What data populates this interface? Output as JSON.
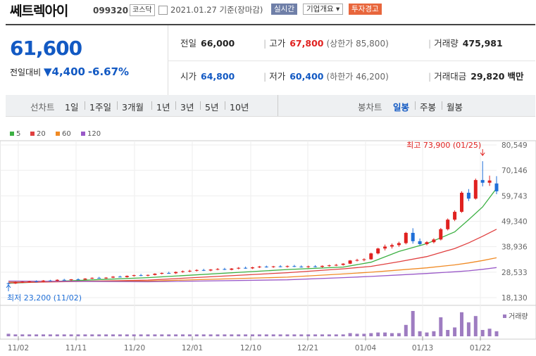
{
  "header": {
    "name": "쎄트렉아이",
    "code": "099320",
    "market": "코스닥",
    "date": "2021.01.27 기준(장마감)",
    "realtime": "실시간",
    "overview": "기업개요 ▾",
    "warning": "투자경고"
  },
  "quote": {
    "price": "61,600",
    "change_label": "전일대비",
    "change": "▼4,400",
    "change_pct": "-6.67%",
    "prev_close_label": "전일",
    "prev_close": "66,000",
    "high_label": "고가",
    "high": "67,800",
    "upper_limit": "(상한가 85,800)",
    "volume_label": "거래량",
    "volume": "475,981",
    "open_label": "시가",
    "open": "64,800",
    "low_label": "저가",
    "low": "60,400",
    "lower_limit": "(하한가 46,200)",
    "amount_label": "거래대금",
    "amount": "29,820",
    "amount_unit": "백만"
  },
  "periods": {
    "line_label": "선차트",
    "line_items": [
      "1일",
      "1주일",
      "3개월",
      "1년",
      "3년",
      "5년",
      "10년"
    ],
    "candle_label": "봉차트",
    "candle_items": [
      "일봉",
      "주봉",
      "월봉"
    ],
    "active": "일봉"
  },
  "chart_data": {
    "type": "candlestick",
    "legend": [
      {
        "name": "5",
        "color": "#3cb043"
      },
      {
        "name": "20",
        "color": "#e04040"
      },
      {
        "name": "60",
        "color": "#f08a24"
      },
      {
        "name": "120",
        "color": "#9a59c8"
      }
    ],
    "y_ticks": [
      "80,549",
      "70,146",
      "59,743",
      "49,340",
      "38,936",
      "28,533",
      "18,130"
    ],
    "x_ticks": [
      "11/02",
      "11/11",
      "11/20",
      "12/01",
      "12/10",
      "12/21",
      "01/04",
      "01/13",
      "01/22"
    ],
    "ylim": [
      18130,
      80549
    ],
    "max_label": "최고 73,900 (01/25)",
    "min_label": "최저 23,200 (11/02)",
    "volume_label": "거래량",
    "up_color": "#e0211f",
    "down_color": "#1f6fd8",
    "volume_color": "#9e7cc1",
    "candles": [
      [
        24000,
        24300,
        23200,
        23900
      ],
      [
        23900,
        24600,
        23700,
        24400
      ],
      [
        24400,
        24800,
        24100,
        24600
      ],
      [
        24600,
        25000,
        24300,
        24800
      ],
      [
        24800,
        25200,
        24400,
        24700
      ],
      [
        24700,
        25300,
        24500,
        25100
      ],
      [
        25100,
        25400,
        24800,
        25000
      ],
      [
        25000,
        25600,
        24800,
        25400
      ],
      [
        25400,
        25800,
        25100,
        25300
      ],
      [
        25300,
        25700,
        25000,
        25600
      ],
      [
        25600,
        26000,
        25300,
        25500
      ],
      [
        25500,
        26100,
        25400,
        25900
      ],
      [
        25900,
        26400,
        25700,
        26200
      ],
      [
        26200,
        26600,
        25900,
        26000
      ],
      [
        26000,
        26500,
        25800,
        26300
      ],
      [
        26300,
        26900,
        26100,
        26700
      ],
      [
        26700,
        27100,
        26400,
        26500
      ],
      [
        26500,
        27200,
        26300,
        27000
      ],
      [
        27000,
        27500,
        26700,
        27300
      ],
      [
        27300,
        27800,
        26900,
        27100
      ],
      [
        27100,
        27600,
        26800,
        27400
      ],
      [
        27400,
        28100,
        27200,
        27900
      ],
      [
        27900,
        28400,
        27600,
        28200
      ],
      [
        28200,
        28700,
        27900,
        28100
      ],
      [
        28100,
        28800,
        27800,
        28600
      ],
      [
        28600,
        29200,
        28300,
        28900
      ],
      [
        28900,
        29500,
        28500,
        29100
      ],
      [
        29100,
        29700,
        28800,
        29400
      ],
      [
        29400,
        29900,
        29000,
        29200
      ],
      [
        29200,
        29800,
        28900,
        29600
      ],
      [
        29600,
        30200,
        29300,
        29800
      ],
      [
        29800,
        30300,
        29400,
        29500
      ],
      [
        29500,
        30200,
        29300,
        30000
      ],
      [
        30000,
        30600,
        29700,
        30300
      ],
      [
        30300,
        30800,
        29900,
        30100
      ],
      [
        30100,
        30700,
        29800,
        30500
      ],
      [
        30500,
        31100,
        30200,
        30800
      ],
      [
        30800,
        31200,
        30400,
        30600
      ],
      [
        30600,
        31100,
        30300,
        30900
      ],
      [
        30900,
        31400,
        30500,
        30700
      ],
      [
        30700,
        31300,
        30400,
        31000
      ],
      [
        31000,
        31500,
        30600,
        30800
      ],
      [
        30800,
        31300,
        30400,
        30600
      ],
      [
        30600,
        31200,
        30300,
        30900
      ],
      [
        30900,
        31400,
        30500,
        30700
      ],
      [
        30700,
        31300,
        30400,
        31100
      ],
      [
        31100,
        31600,
        30800,
        31300
      ],
      [
        31300,
        31900,
        31000,
        31500
      ],
      [
        31500,
        32200,
        31200,
        32000
      ],
      [
        32000,
        33500,
        31800,
        33300
      ],
      [
        33300,
        34000,
        32900,
        33500
      ],
      [
        33500,
        34200,
        33000,
        33800
      ],
      [
        33800,
        36500,
        33600,
        36200
      ],
      [
        36200,
        38500,
        35800,
        38200
      ],
      [
        38200,
        39800,
        37400,
        39000
      ],
      [
        39000,
        40200,
        38200,
        39600
      ],
      [
        39600,
        41000,
        38900,
        40400
      ],
      [
        40400,
        45000,
        39900,
        44600
      ],
      [
        44600,
        46500,
        40200,
        41200
      ],
      [
        41200,
        42300,
        39600,
        40000
      ],
      [
        40000,
        41200,
        39500,
        40800
      ],
      [
        40800,
        42400,
        40300,
        41900
      ],
      [
        41900,
        46600,
        41500,
        46100
      ],
      [
        46100,
        50500,
        45600,
        50000
      ],
      [
        50000,
        53800,
        49400,
        53200
      ],
      [
        53200,
        61600,
        52800,
        61000
      ],
      [
        61000,
        62500,
        57600,
        58600
      ],
      [
        58600,
        66800,
        58200,
        66200
      ],
      [
        66200,
        73900,
        63600,
        65100
      ],
      [
        65100,
        68000,
        63800,
        66000
      ],
      [
        64800,
        67800,
        60400,
        61600
      ]
    ],
    "volumes": [
      4,
      3,
      3,
      3,
      3,
      3,
      3,
      3,
      3,
      3,
      3,
      3,
      3,
      3,
      3,
      3,
      3,
      3,
      3,
      3,
      3,
      3,
      3,
      3,
      3,
      3,
      3,
      3,
      3,
      3,
      3,
      3,
      3,
      3,
      3,
      3,
      3,
      3,
      3,
      3,
      3,
      3,
      3,
      3,
      3,
      3,
      3,
      3,
      3,
      5,
      4,
      4,
      5,
      6,
      6,
      5,
      5,
      18,
      40,
      8,
      6,
      8,
      30,
      10,
      14,
      38,
      22,
      32,
      10,
      12,
      8
    ],
    "ma": {
      "5": [
        [
          0,
          24000
        ],
        [
          20,
          26300
        ],
        [
          40,
          29600
        ],
        [
          48,
          30600
        ],
        [
          52,
          32600
        ],
        [
          56,
          37000
        ],
        [
          60,
          40200
        ],
        [
          64,
          45000
        ],
        [
          66,
          50000
        ],
        [
          68,
          55200
        ],
        [
          70,
          62800
        ]
      ],
      "20": [
        [
          0,
          24200
        ],
        [
          20,
          25300
        ],
        [
          40,
          28300
        ],
        [
          48,
          29900
        ],
        [
          52,
          30900
        ],
        [
          56,
          32800
        ],
        [
          60,
          34900
        ],
        [
          64,
          38200
        ],
        [
          66,
          40500
        ],
        [
          68,
          43200
        ],
        [
          70,
          46100
        ]
      ],
      "60": [
        [
          0,
          24700
        ],
        [
          20,
          24900
        ],
        [
          40,
          26500
        ],
        [
          48,
          27800
        ],
        [
          52,
          28500
        ],
        [
          56,
          29400
        ],
        [
          60,
          30300
        ],
        [
          64,
          31500
        ],
        [
          66,
          32300
        ],
        [
          68,
          33300
        ],
        [
          70,
          34400
        ]
      ],
      "120": [
        [
          0,
          24900
        ],
        [
          20,
          24600
        ],
        [
          40,
          25400
        ],
        [
          48,
          26300
        ],
        [
          52,
          26800
        ],
        [
          56,
          27400
        ],
        [
          60,
          28000
        ],
        [
          64,
          28700
        ],
        [
          66,
          29100
        ],
        [
          68,
          29700
        ],
        [
          70,
          30400
        ]
      ]
    }
  }
}
